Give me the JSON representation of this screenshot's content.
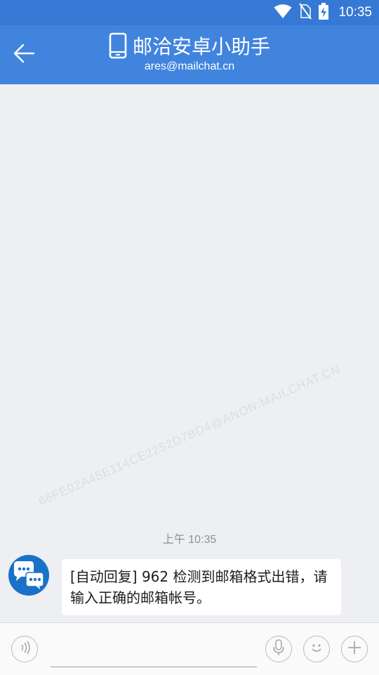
{
  "status_bar": {
    "time": "10:35",
    "icons": [
      "wifi-icon",
      "no-sim-icon",
      "battery-charging-icon"
    ]
  },
  "header": {
    "title": "邮洽安卓小助手",
    "subtitle": "ares@mailchat.cn",
    "icons": [
      "back-arrow-icon",
      "phone-icon"
    ]
  },
  "conversation": {
    "watermark": "66FE02A45E114CE2252D7BD4@ANON.MAILCHAT.CN",
    "timestamp": "上午 10:35",
    "messages": [
      {
        "sender_avatar": "chat-bubbles-avatar",
        "text": "[自动回复] 962 检测到邮箱格式出错，请输入正确的邮箱帐号。"
      }
    ]
  },
  "input_bar": {
    "value": "",
    "icons": [
      "voice-wave-icon",
      "microphone-icon",
      "emoji-icon",
      "plus-icon"
    ]
  },
  "colors": {
    "status_bar": "#3679d4",
    "header": "#4184de",
    "background": "#edeff3",
    "bubble": "#ffffff",
    "avatar": "#1a72c8"
  }
}
